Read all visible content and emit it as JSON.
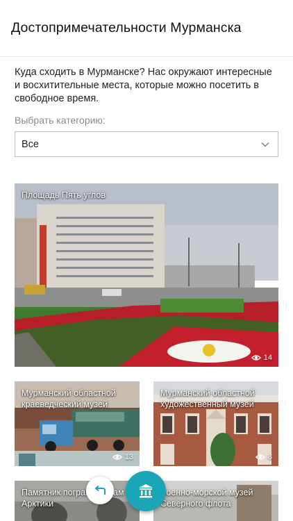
{
  "header": {
    "title": "Достопримечательности Мурманска"
  },
  "intro": {
    "text": "Куда сходить в Мурманске? Нас окружают интересные и восхитительные места, которые можно посетить в свободное время."
  },
  "category": {
    "label": "Выбрать категорию:",
    "selected": "Все",
    "icon": "chevron-down-icon"
  },
  "cards": [
    {
      "title": "Площадь Пять углов",
      "views": "14"
    },
    {
      "title": "Мурманский областной краеведческий музей",
      "views": "13"
    },
    {
      "title": "Мурманский областной художественный музей",
      "views": "8"
    },
    {
      "title": "Памятник пограничникам Арктики",
      "views": ""
    },
    {
      "title": "Военно-морской музей Северного флота",
      "views": ""
    }
  ],
  "fabs": {
    "back_icon": "back-arrow-icon",
    "main_icon": "museum-icon"
  },
  "colors": {
    "accent": "#1aa6b7",
    "back_arrow": "#1aa6b7"
  }
}
